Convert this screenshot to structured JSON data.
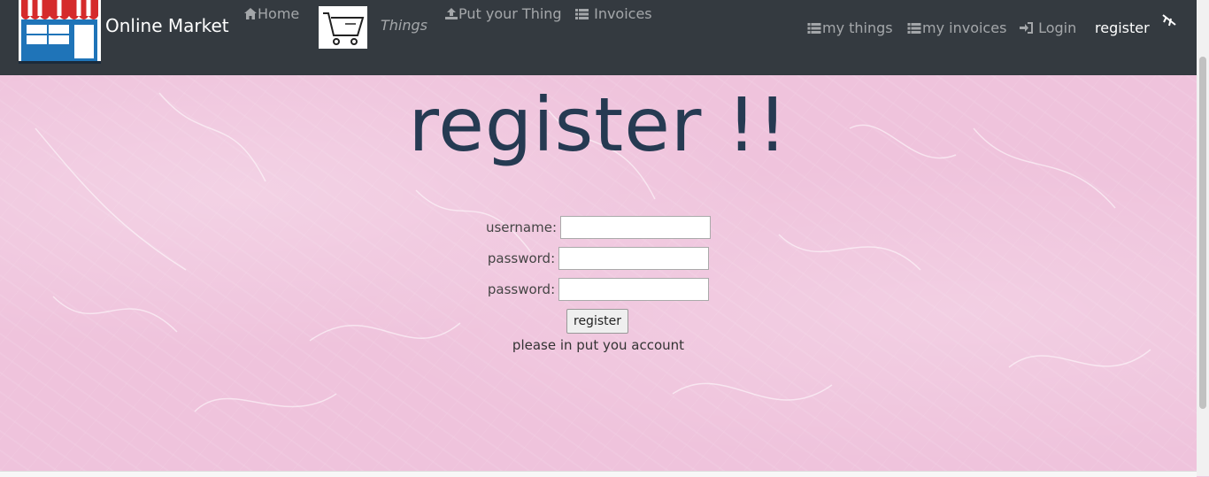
{
  "navbar": {
    "brand": "Online Market",
    "home": "Home",
    "things": "Things",
    "put_your_thing": "Put your Thing",
    "invoices": "Invoices",
    "my_things": "my things",
    "my_invoices": "my invoices",
    "login": "Login",
    "register": "register"
  },
  "main": {
    "title": "register !!",
    "username_label": "username:",
    "password_label": "password:",
    "password2_label": "password:",
    "username_value": "",
    "password_value": "",
    "password2_value": "",
    "submit_label": "register",
    "hint": "please in put you account"
  }
}
